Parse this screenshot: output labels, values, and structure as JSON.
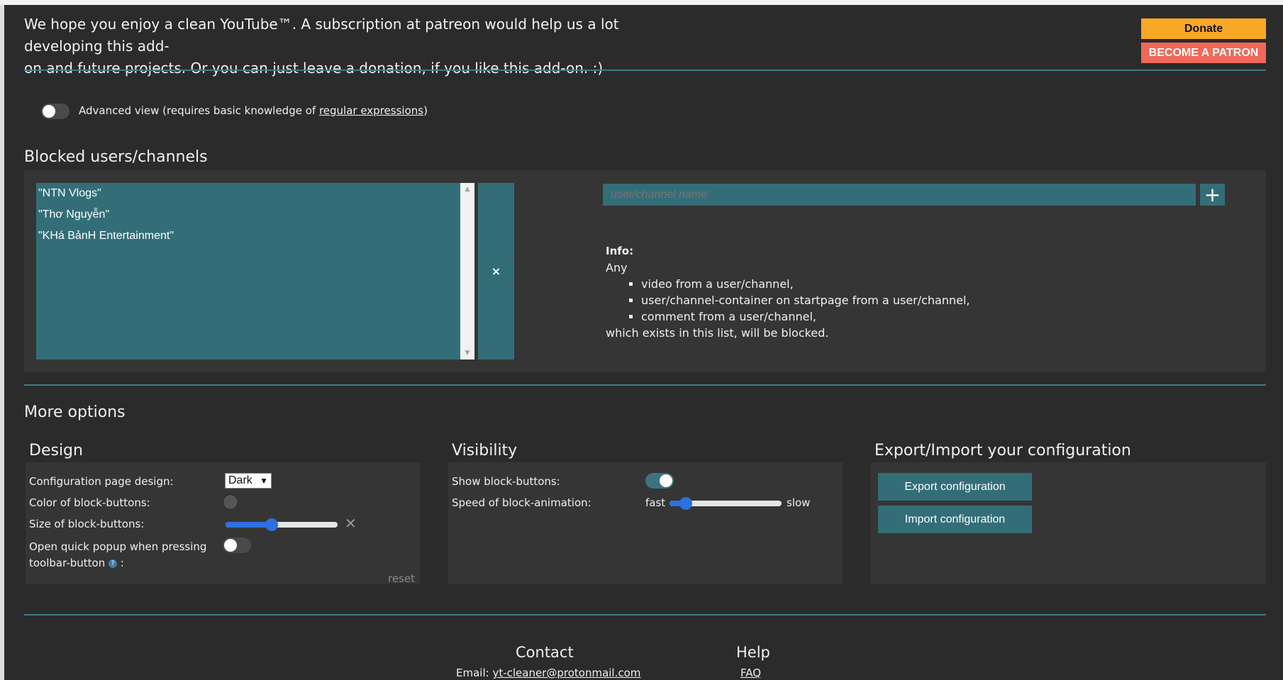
{
  "header": {
    "intro_line1": "We hope you enjoy a clean YouTube™. A subscription at patreon would help us a lot developing this add-",
    "intro_line2": "on and future projects. Or you can just leave a donation, if you like this add-on. :)",
    "donate_label": "Donate",
    "patron_label": "BECOME A PATRON"
  },
  "advanced_view": {
    "label_prefix": "Advanced view (requires basic knowledge of ",
    "link_text": "regular expressions",
    "label_suffix": ")",
    "enabled": false
  },
  "blocked": {
    "title": "Blocked users/channels",
    "items": [
      "\"NTN Vlogs\"",
      "\"Thơ Nguyễn\"",
      "\"KHá BảnH Entertainment\""
    ],
    "delete_label": "×",
    "input_placeholder": "user/channel name",
    "add_label": "+",
    "info_title": "Info:",
    "info_any": "Any",
    "info_items": [
      "video from a user/channel,",
      "user/channel-container on startpage from a user/channel,",
      "comment from a user/channel,"
    ],
    "info_footer": "which exists in this list, will be blocked."
  },
  "more_options": {
    "title": "More options",
    "design": {
      "title": "Design",
      "config_page_design_label": "Configuration page design:",
      "config_page_design_value": "Dark",
      "color_label": "Color of block-buttons:",
      "color_value": "#555555",
      "size_label": "Size of block-buttons:",
      "size_level": 0.4,
      "size_reset_icon": "✕",
      "popup_label_line1": "Open quick popup when pressing",
      "popup_label_line2": "toolbar-button",
      "popup_label_colon": " :",
      "help_icon": "?",
      "popup_enabled": false,
      "reset_label": "reset"
    },
    "visibility": {
      "title": "Visibility",
      "show_label": "Show block-buttons:",
      "show_enabled": true,
      "speed_label": "Speed of block-animation:",
      "speed_fast": "fast",
      "speed_slow": "slow",
      "speed_level": 0.1
    },
    "export_import": {
      "title": "Export/Import your configuration",
      "export_label": "Export configuration",
      "import_label": "Import configuration"
    }
  },
  "footer": {
    "contact_title": "Contact",
    "email_prefix": "Email: ",
    "email": "yt-cleaner@protonmail.com",
    "help_title": "Help",
    "faq": "FAQ"
  },
  "colors": {
    "accent": "#336e78",
    "donate": "#f9a825",
    "patron": "#f0685a",
    "background": "#2b2b2b"
  }
}
